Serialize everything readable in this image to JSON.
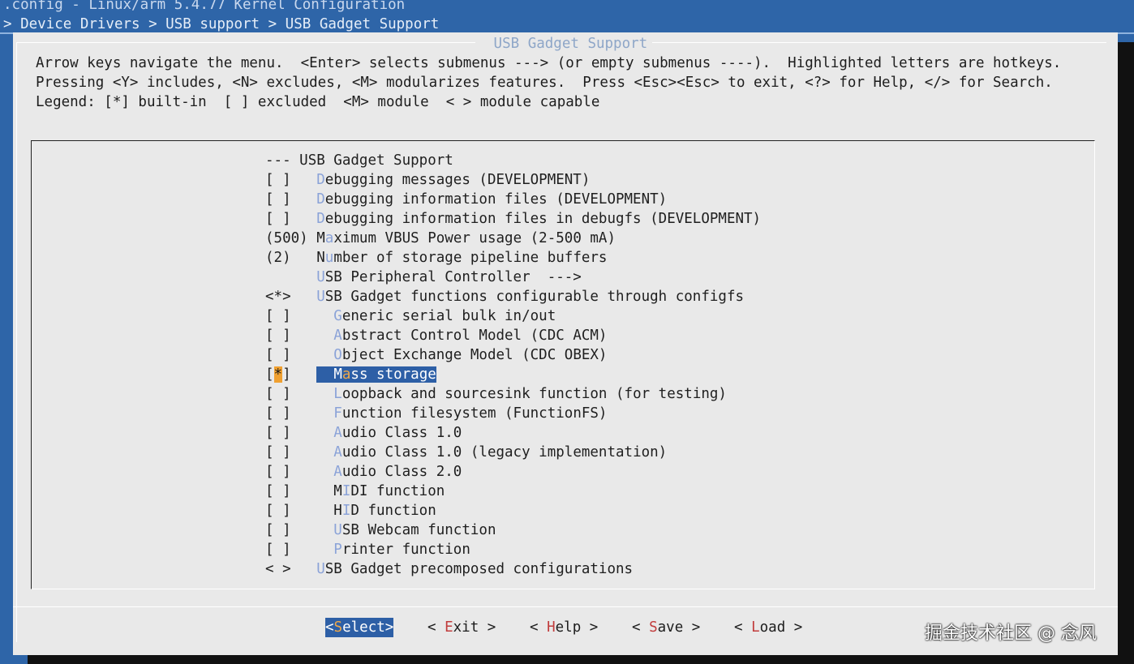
{
  "window": {
    "title": ".config - Linux/arm 5.4.77 Kernel Configuration",
    "breadcrumb": "> Device Drivers > USB support > USB Gadget Support"
  },
  "dialog": {
    "title": "USB Gadget Support",
    "help_lines": [
      "Arrow keys navigate the menu.  <Enter> selects submenus ---> (or empty submenus ----).  Highlighted letters are hotkeys.",
      "Pressing <Y> includes, <N> excludes, <M> modularizes features.  Press <Esc><Esc> to exit, <?> for Help, </> for Search.",
      "Legend: [*] built-in  [ ] excluded  <M> module  < > module capable"
    ]
  },
  "menu": {
    "items": [
      {
        "prefix": "--- ",
        "indent": "",
        "hk": "",
        "rest": "USB Gadget Support"
      },
      {
        "prefix": "[ ]   ",
        "indent": "",
        "hk": "D",
        "rest": "ebugging messages (DEVELOPMENT)"
      },
      {
        "prefix": "[ ]   ",
        "indent": "",
        "hk": "D",
        "rest": "ebugging information files (DEVELOPMENT)"
      },
      {
        "prefix": "[ ]   ",
        "indent": "",
        "hk": "D",
        "rest": "ebugging information files in debugfs (DEVELOPMENT)"
      },
      {
        "prefix": "(500) ",
        "indent": "",
        "pre": "M",
        "hk": "a",
        "rest": "ximum VBUS Power usage (2-500 mA)"
      },
      {
        "prefix": "(2)   ",
        "indent": "",
        "pre": "N",
        "hk": "u",
        "rest": "mber of storage pipeline buffers"
      },
      {
        "prefix": "      ",
        "indent": "",
        "hk": "U",
        "rest": "SB Peripheral Controller  --->"
      },
      {
        "prefix": "<*>   ",
        "indent": "",
        "hk": "U",
        "rest": "SB Gadget functions configurable through configfs"
      },
      {
        "prefix": "[ ]   ",
        "indent": "  ",
        "hk": "G",
        "rest": "eneric serial bulk in/out"
      },
      {
        "prefix": "[ ]   ",
        "indent": "  ",
        "hk": "A",
        "rest": "bstract Control Model (CDC ACM)"
      },
      {
        "prefix": "[ ]   ",
        "indent": "  ",
        "hk": "O",
        "rest": "bject Exchange Model (CDC OBEX)"
      },
      {
        "prefix": "[*]   ",
        "indent": "  ",
        "pre": "M",
        "hk": "a",
        "rest": "ss storage",
        "selected": true
      },
      {
        "prefix": "[ ]   ",
        "indent": "  ",
        "hk": "L",
        "rest": "oopback and sourcesink function (for testing)"
      },
      {
        "prefix": "[ ]   ",
        "indent": "  ",
        "hk": "F",
        "rest": "unction filesystem (FunctionFS)"
      },
      {
        "prefix": "[ ]   ",
        "indent": "  ",
        "hk": "A",
        "rest": "udio Class 1.0"
      },
      {
        "prefix": "[ ]   ",
        "indent": "  ",
        "hk": "A",
        "rest": "udio Class 1.0 (legacy implementation)"
      },
      {
        "prefix": "[ ]   ",
        "indent": "  ",
        "hk": "A",
        "rest": "udio Class 2.0"
      },
      {
        "prefix": "[ ]   ",
        "indent": "  ",
        "pre": "M",
        "hk": "I",
        "rest": "DI function"
      },
      {
        "prefix": "[ ]   ",
        "indent": "  ",
        "pre": "H",
        "hk": "I",
        "rest": "D function"
      },
      {
        "prefix": "[ ]   ",
        "indent": "  ",
        "hk": "U",
        "rest": "SB Webcam function"
      },
      {
        "prefix": "[ ]   ",
        "indent": "  ",
        "hk": "P",
        "rest": "rinter function"
      },
      {
        "prefix": "< >   ",
        "indent": "",
        "hk": "U",
        "rest": "SB Gadget precomposed configurations"
      }
    ]
  },
  "buttons": [
    {
      "name": "select-button",
      "l": "<",
      "pre": "",
      "hk": "S",
      "rest": "elect",
      "r": ">",
      "active": true
    },
    {
      "name": "exit-button",
      "l": "< ",
      "pre": "",
      "hk": "E",
      "rest": "xit",
      "r": " >",
      "active": false
    },
    {
      "name": "help-button",
      "l": "< ",
      "pre": "",
      "hk": "H",
      "rest": "elp",
      "r": " >",
      "active": false
    },
    {
      "name": "save-button",
      "l": "< ",
      "pre": "",
      "hk": "S",
      "rest": "ave",
      "r": " >",
      "active": false
    },
    {
      "name": "load-button",
      "l": "< ",
      "pre": "",
      "hk": "L",
      "rest": "oad",
      "r": " >",
      "active": false
    }
  ],
  "watermark": "掘金技术社区 @ 念风",
  "colors": {
    "background": "#2e65a8",
    "dialog": "#e9e9e9",
    "highlight": "#2d5fa6",
    "hotkey_menu": "#8ba3d8",
    "hotkey_button": "#c13c3c",
    "cursor": "#f0a030"
  }
}
